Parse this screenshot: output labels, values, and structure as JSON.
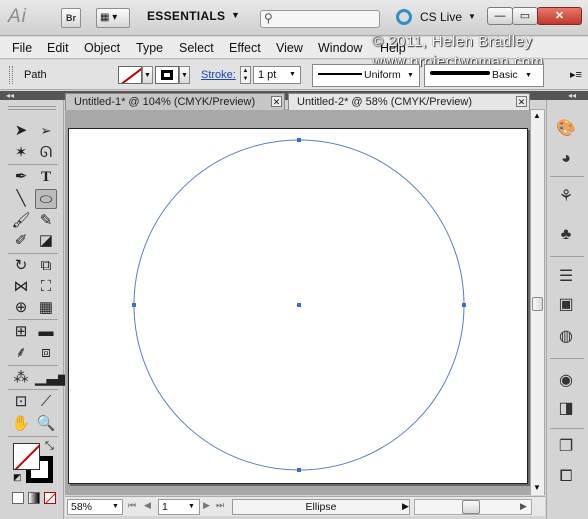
{
  "app": {
    "logo": "Ai",
    "bridge_label": "Br",
    "workspace": "ESSENTIALS",
    "search_placeholder": "",
    "cslive_label": "CS Live"
  },
  "window_controls": {
    "minimize": "—",
    "maximize": "▭",
    "close": "✕"
  },
  "menu": [
    "File",
    "Edit",
    "Object",
    "Type",
    "Select",
    "Effect",
    "View",
    "Window",
    "Help"
  ],
  "watermark": {
    "copyright": "© 2011, Helen Bradley",
    "website": "www.projectwoman.com"
  },
  "control_bar": {
    "selection_type": "Path",
    "stroke_label": "Stroke:",
    "stroke_weight": "1 pt",
    "variable_width_profile": "Uniform",
    "brush_definition": "Basic"
  },
  "documents": {
    "tabs": [
      {
        "title": "Untitled-1* @ 104% (CMYK/Preview)",
        "active": false
      },
      {
        "title": "Untitled-2* @ 58% (CMYK/Preview)",
        "active": true
      }
    ]
  },
  "canvas": {
    "shape": "ellipse",
    "stroke_color": "#5a7fb5",
    "anchor_color": "#3a6fd0"
  },
  "status_bar": {
    "zoom": "58%",
    "artboard_number": "1",
    "status_text": "Ellipse"
  },
  "tools": [
    "selection-tool",
    "direct-selection-tool",
    "magic-wand-tool",
    "lasso-tool",
    "pen-tool",
    "type-tool",
    "line-segment-tool",
    "ellipse-tool",
    "paintbrush-tool",
    "pencil-tool",
    "blob-brush-tool",
    "eraser-tool",
    "rotate-tool",
    "scale-tool",
    "width-tool",
    "free-transform-tool",
    "shape-builder-tool",
    "perspective-grid-tool",
    "mesh-tool",
    "gradient-tool",
    "eyedropper-tool",
    "blend-tool",
    "symbol-sprayer-tool",
    "column-graph-tool",
    "artboard-tool",
    "slice-tool",
    "hand-tool",
    "zoom-tool"
  ],
  "dock_panels": [
    "color-panel",
    "color-guide-panel",
    "brushes-panel",
    "symbols-panel",
    "stroke-panel",
    "gradient-panel",
    "transparency-panel",
    "appearance-panel",
    "graphic-styles-panel",
    "layers-panel",
    "artboards-panel"
  ]
}
